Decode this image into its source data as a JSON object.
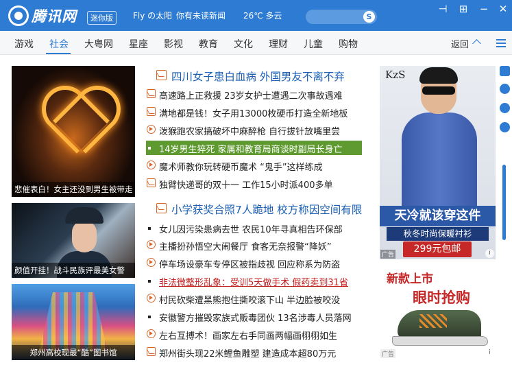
{
  "titlebar": {
    "brand": "腾讯网",
    "badge": "迷你版",
    "user": "Fly の太阳",
    "unread": "你有未读新闻",
    "weather": "26℃  多云",
    "search_icon": "S"
  },
  "window_buttons": {
    "pin": "⊣",
    "add": "⊞",
    "minimize": "−",
    "close": "✕"
  },
  "nav": {
    "tabs": [
      "游戏",
      "社会",
      "大粤网",
      "星座",
      "影视",
      "教育",
      "文化",
      "理财",
      "儿童",
      "购物"
    ],
    "active_tab": "社会",
    "return_label": "返回"
  },
  "image_cards": [
    {
      "caption": "悲催表白！女主还没到男生被带走"
    },
    {
      "caption": "颜值开挂！战斗民族评最美女警"
    },
    {
      "caption": "郑州高校现最“酷”图书馆"
    }
  ],
  "news": {
    "headline1": "四川女子患白血病 外国男友不离不弃",
    "block1": [
      {
        "icon": "image",
        "text": "高速路上正救援 23岁女护士遭遇二次事故遇难"
      },
      {
        "icon": "image",
        "text": "满地都是钱！女子用13000枚硬币打造全新地板"
      },
      {
        "icon": "play",
        "text": "泼猴跑农家搞破坏中麻醉枪 自行拔针放嘴里尝"
      },
      {
        "icon": "bullet",
        "text": "14岁男生猝死 家属和教育局商谈时副局长身亡",
        "selected": true
      },
      {
        "icon": "play",
        "text": "魔术师教你玩转硬币魔术 “鬼手”这样练成"
      },
      {
        "icon": "image",
        "text": "独臂快递哥的双十一 工作15小时派400多单"
      }
    ],
    "headline2": "小学获奖合照7人跪地 校方称因空间有限",
    "block2": [
      {
        "icon": "bullet",
        "text": "女儿因污染患病去世 农民10年寻真相告环保部"
      },
      {
        "icon": "play",
        "text": "主播扮孙悟空大闹餐厅 食客无奈报警“降妖”"
      },
      {
        "icon": "play",
        "text": "停车场设豪车专停区被指歧视 回应称系为防盗"
      },
      {
        "icon": "bullet",
        "text": "非法微整形乱象：受训5天做手术 假药卖到31省",
        "red": true
      },
      {
        "icon": "play",
        "text": "村民砍柴遭黑熊抱住撕咬滚下山 半边脸被咬没"
      },
      {
        "icon": "bullet",
        "text": "安徽警方摧毁家族式贩毒团伙 13名涉毒人员落网"
      },
      {
        "icon": "play",
        "text": "左右互搏术！画家左右手同画两幅画栩栩如生"
      },
      {
        "icon": "image",
        "text": "郑州街头现22米鲤鱼雕塑 建造成本超80万元"
      }
    ]
  },
  "ads": {
    "ad1": {
      "brand": "KzS",
      "line1": "天冷就该穿这件",
      "line2": "秋冬时尚保暖衬衫",
      "price": "299元包邮",
      "tag": "广告",
      "info": "i"
    },
    "ad2": {
      "line1": "新款上市",
      "line2": "眼时抢购",
      "tag": "广告",
      "info": "i"
    }
  },
  "sidebar_icons": [
    "mail-icon",
    "qq-icon",
    "video-icon",
    "settings-icon"
  ],
  "colors": {
    "primary": "#2e7bd3",
    "selected_row": "#5e9a2f",
    "alert_red": "#c21b1b",
    "icon_orange": "#d8662a"
  }
}
